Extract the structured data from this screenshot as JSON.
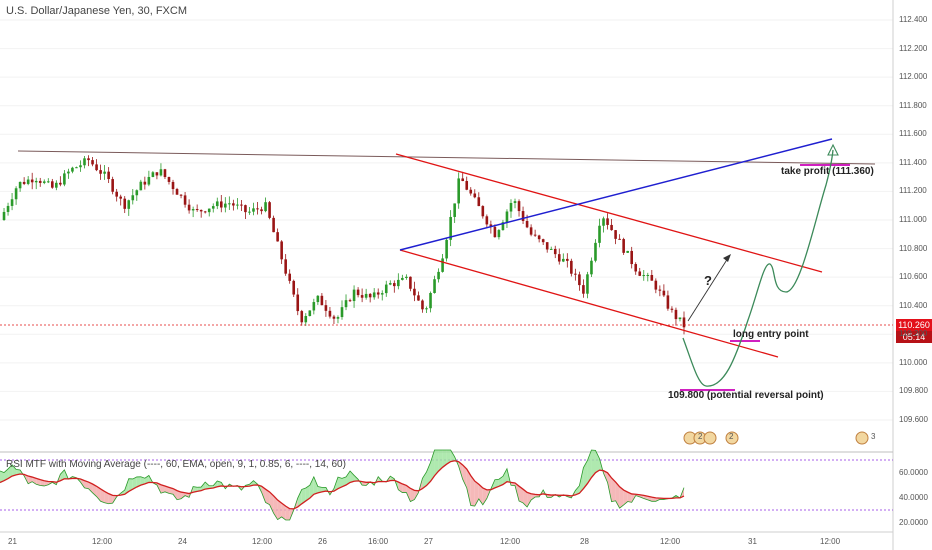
{
  "header": {
    "title": "U.S. Dollar/Japanese Yen, 30, FXCM"
  },
  "indicator": {
    "title": "RSI MTF with Moving Average (----, 60, EMA, open, 9, 1, 0.85, 6, ----, 14, 60)",
    "labels": [
      "60.0000",
      "40.0000",
      "20.0000"
    ]
  },
  "price_axis": {
    "labels": [
      "112.400",
      "112.200",
      "112.000",
      "111.800",
      "111.600",
      "111.400",
      "111.200",
      "111.000",
      "110.800",
      "110.600",
      "110.400",
      "110.200",
      "110.000",
      "109.800",
      "109.600"
    ],
    "current_price": "110.260",
    "countdown": "05:14"
  },
  "time_axis": {
    "labels": [
      "21",
      "12:00",
      "24",
      "12:00",
      "26",
      "16:00",
      "27",
      "12:00",
      "28",
      "12:00",
      "31",
      "12:00"
    ]
  },
  "annotations": {
    "question": "?",
    "take_profit": "take profit (111.360)",
    "long_entry": "long entry point",
    "reversal": "109.800 (potential reversal point)"
  },
  "events": {
    "badge_one": "2",
    "badge_two": "2",
    "badge_three": "3"
  },
  "colors": {
    "bull": "#2a9a2a",
    "bear": "#9a1515",
    "channel": "#e01414",
    "trendline_blue": "#1f1fd0",
    "resistance": "#7a5a5a",
    "projection": "#3c8a5a",
    "price_line": "#e01414",
    "marker": "#d020c0"
  },
  "chart_data": {
    "type": "candlestick",
    "title": "U.S. Dollar/Japanese Yen, 30, FXCM",
    "ylim": [
      109.4,
      112.5
    ],
    "x_ticks": [
      "21",
      "12:00",
      "24",
      "12:00",
      "26",
      "16:00",
      "27",
      "12:00",
      "28",
      "12:00",
      "31",
      "12:00"
    ],
    "close_path": [
      {
        "t": 0,
        "c": 111.0
      },
      {
        "t": 6,
        "c": 111.25
      },
      {
        "t": 12,
        "c": 111.3
      },
      {
        "t": 18,
        "c": 111.22
      },
      {
        "t": 24,
        "c": 111.35
      },
      {
        "t": 30,
        "c": 111.42
      },
      {
        "t": 36,
        "c": 111.3
      },
      {
        "t": 42,
        "c": 111.1
      },
      {
        "t": 48,
        "c": 111.25
      },
      {
        "t": 54,
        "c": 111.35
      },
      {
        "t": 60,
        "c": 111.2
      },
      {
        "t": 66,
        "c": 111.05
      },
      {
        "t": 72,
        "c": 111.1
      },
      {
        "t": 78,
        "c": 111.12
      },
      {
        "t": 84,
        "c": 111.05
      },
      {
        "t": 90,
        "c": 111.1
      },
      {
        "t": 96,
        "c": 110.7
      },
      {
        "t": 102,
        "c": 110.3
      },
      {
        "t": 108,
        "c": 110.45
      },
      {
        "t": 114,
        "c": 110.3
      },
      {
        "t": 120,
        "c": 110.5
      },
      {
        "t": 126,
        "c": 110.45
      },
      {
        "t": 132,
        "c": 110.55
      },
      {
        "t": 138,
        "c": 110.58
      },
      {
        "t": 144,
        "c": 110.35
      },
      {
        "t": 150,
        "c": 110.75
      },
      {
        "t": 156,
        "c": 111.3
      },
      {
        "t": 162,
        "c": 111.1
      },
      {
        "t": 168,
        "c": 110.9
      },
      {
        "t": 174,
        "c": 111.15
      },
      {
        "t": 180,
        "c": 110.9
      },
      {
        "t": 186,
        "c": 110.8
      },
      {
        "t": 192,
        "c": 110.7
      },
      {
        "t": 198,
        "c": 110.5
      },
      {
        "t": 204,
        "c": 111.05
      },
      {
        "t": 210,
        "c": 110.85
      },
      {
        "t": 216,
        "c": 110.65
      },
      {
        "t": 222,
        "c": 110.55
      },
      {
        "t": 228,
        "c": 110.35
      },
      {
        "t": 232,
        "c": 110.26
      }
    ],
    "overlays": {
      "resistance": [
        111.45,
        111.38
      ],
      "channel_upper": [
        111.48,
        110.65
      ],
      "channel_lower": [
        110.78,
        110.05
      ],
      "blue_trendline": [
        110.78,
        111.55
      ],
      "take_profit": 111.36,
      "reversal": 109.8,
      "current": 110.26
    },
    "rsi": {
      "levels": [
        70,
        30
      ],
      "ticks": [
        60,
        40,
        20
      ]
    }
  }
}
